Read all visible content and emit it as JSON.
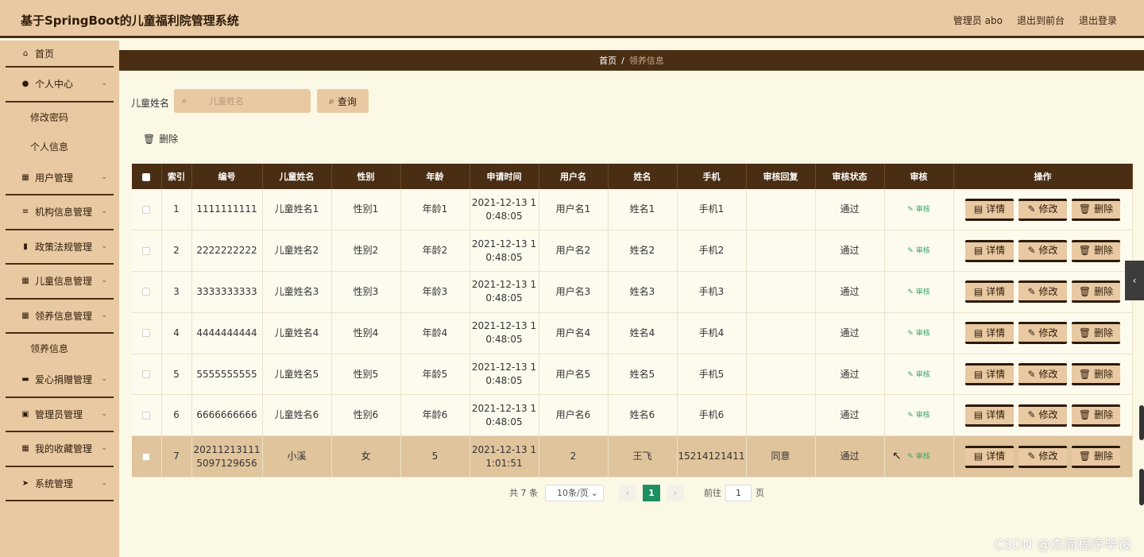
{
  "header": {
    "title": "基于SpringBoot的儿童福利院管理系统",
    "admin": "管理员 abo",
    "to_front": "退出到前台",
    "logout": "退出登录"
  },
  "sidebar": {
    "items": [
      {
        "label": "首页",
        "icon": "home-icon"
      },
      {
        "label": "个人中心",
        "icon": "user-icon",
        "sub": [
          "修改密码",
          "个人信息"
        ]
      },
      {
        "label": "用户管理",
        "icon": "grid-icon"
      },
      {
        "label": "机构信息管理",
        "icon": "list-icon"
      },
      {
        "label": "政策法规管理",
        "icon": "book-icon"
      },
      {
        "label": "儿童信息管理",
        "icon": "grid-icon"
      },
      {
        "label": "领养信息管理",
        "icon": "grid-icon",
        "sub": [
          "领养信息"
        ]
      },
      {
        "label": "爱心捐赠管理",
        "icon": "box-icon"
      },
      {
        "label": "管理员管理",
        "icon": "case-icon"
      },
      {
        "label": "我的收藏管理",
        "icon": "grid-icon"
      },
      {
        "label": "系统管理",
        "icon": "send-icon"
      }
    ]
  },
  "breadcrumb": {
    "home": "首页",
    "sep": "/",
    "current": "领养信息"
  },
  "search": {
    "label": "儿童姓名",
    "placeholder": "儿童姓名",
    "button": "查询"
  },
  "toolbar": {
    "delete": "删除"
  },
  "table": {
    "headers": [
      "索引",
      "编号",
      "儿童姓名",
      "性别",
      "年龄",
      "申请时间",
      "用户名",
      "姓名",
      "手机",
      "审核回复",
      "审核状态",
      "审核",
      "操作"
    ],
    "audit_label": "审核",
    "actions": {
      "detail": "详情",
      "edit": "修改",
      "delete": "删除"
    },
    "rows": [
      {
        "index": "1",
        "code": "1111111111",
        "child": "儿童姓名1",
        "gender": "性别1",
        "age": "年龄1",
        "time1": "2021-12-13 1",
        "time2": "0:48:05",
        "user": "用户名1",
        "name": "姓名1",
        "phone": "手机1",
        "reply": "",
        "status": "通过"
      },
      {
        "index": "2",
        "code": "2222222222",
        "child": "儿童姓名2",
        "gender": "性别2",
        "age": "年龄2",
        "time1": "2021-12-13 1",
        "time2": "0:48:05",
        "user": "用户名2",
        "name": "姓名2",
        "phone": "手机2",
        "reply": "",
        "status": "通过"
      },
      {
        "index": "3",
        "code": "3333333333",
        "child": "儿童姓名3",
        "gender": "性别3",
        "age": "年龄3",
        "time1": "2021-12-13 1",
        "time2": "0:48:05",
        "user": "用户名3",
        "name": "姓名3",
        "phone": "手机3",
        "reply": "",
        "status": "通过"
      },
      {
        "index": "4",
        "code": "4444444444",
        "child": "儿童姓名4",
        "gender": "性别4",
        "age": "年龄4",
        "time1": "2021-12-13 1",
        "time2": "0:48:05",
        "user": "用户名4",
        "name": "姓名4",
        "phone": "手机4",
        "reply": "",
        "status": "通过"
      },
      {
        "index": "5",
        "code": "5555555555",
        "child": "儿童姓名5",
        "gender": "性别5",
        "age": "年龄5",
        "time1": "2021-12-13 1",
        "time2": "0:48:05",
        "user": "用户名5",
        "name": "姓名5",
        "phone": "手机5",
        "reply": "",
        "status": "通过"
      },
      {
        "index": "6",
        "code": "6666666666",
        "child": "儿童姓名6",
        "gender": "性别6",
        "age": "年龄6",
        "time1": "2021-12-13 1",
        "time2": "0:48:05",
        "user": "用户名6",
        "name": "姓名6",
        "phone": "手机6",
        "reply": "",
        "status": "通过"
      },
      {
        "index": "7",
        "code": "20211213111",
        "code2": "5097129656",
        "child": "小溪",
        "gender": "女",
        "age": "5",
        "time1": "2021-12-13 1",
        "time2": "1:01:51",
        "user": "2",
        "name": "王飞",
        "phone": "15214121411",
        "reply": "同意",
        "status": "通过"
      }
    ]
  },
  "pager": {
    "total": "共 7 条",
    "size": "10条/页",
    "current": "1",
    "goto": "前往",
    "page_input": "1",
    "page_unit": "页",
    "prev": "‹",
    "next": "›"
  },
  "watermark": "CSDN @杰简程序毕设",
  "colors": {
    "header": "#e8c9a2",
    "dark": "#4a2e14",
    "content_bg": "#fbf9e6",
    "active_page": "#1f8f5f",
    "audit": "#3aa56a"
  }
}
